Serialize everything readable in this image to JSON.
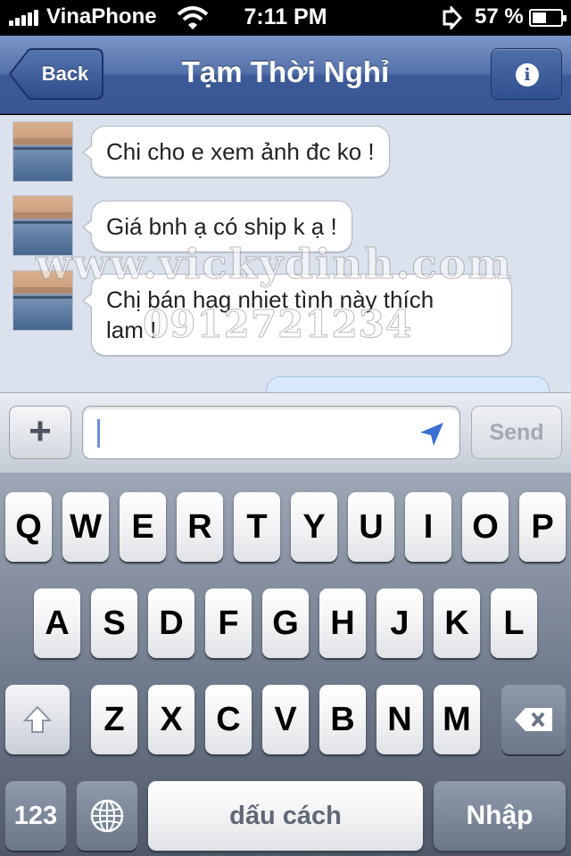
{
  "status_bar": {
    "carrier": "VinaPhone",
    "time": "7:11 PM",
    "battery_percent": "57 %",
    "signal_icon": "signal-bars-icon",
    "wifi_icon": "wifi-icon",
    "location_icon": "location-arrow-icon",
    "battery_level": 0.57
  },
  "nav": {
    "back_label": "Back",
    "title": "Tạm Thời Nghỉ",
    "info_icon": "info-icon"
  },
  "messages": [
    {
      "sender": "incoming",
      "lines": [
        "Chi cho e xem ảnh đc ko !"
      ]
    },
    {
      "sender": "incoming",
      "lines": [
        "Giá bnh ạ có ship k ạ !"
      ]
    },
    {
      "sender": "incoming",
      "lines": [
        "Chị bán hag nhiet tình này thích",
        "lam !"
      ]
    }
  ],
  "watermark": {
    "site": "www.vickydinh.com",
    "phone": "0912721234"
  },
  "composer": {
    "plus_label": "+",
    "input_value": "",
    "send_label": "Send",
    "send_enabled": false
  },
  "keyboard": {
    "row1": [
      "Q",
      "W",
      "E",
      "R",
      "T",
      "Y",
      "U",
      "I",
      "O",
      "P"
    ],
    "row2": [
      "A",
      "S",
      "D",
      "F",
      "G",
      "H",
      "J",
      "K",
      "L"
    ],
    "row3": [
      "Z",
      "X",
      "C",
      "V",
      "B",
      "N",
      "M"
    ],
    "numbers_label": "123",
    "space_label": "dấu cách",
    "return_label": "Nhập",
    "shift_icon": "shift-arrow-icon",
    "delete_icon": "backspace-icon",
    "globe_icon": "globe-icon"
  },
  "colors": {
    "nav_blue": "#3a5794",
    "chat_background": "#dbe2ed",
    "keyboard_gray": "#6f7a8c"
  }
}
